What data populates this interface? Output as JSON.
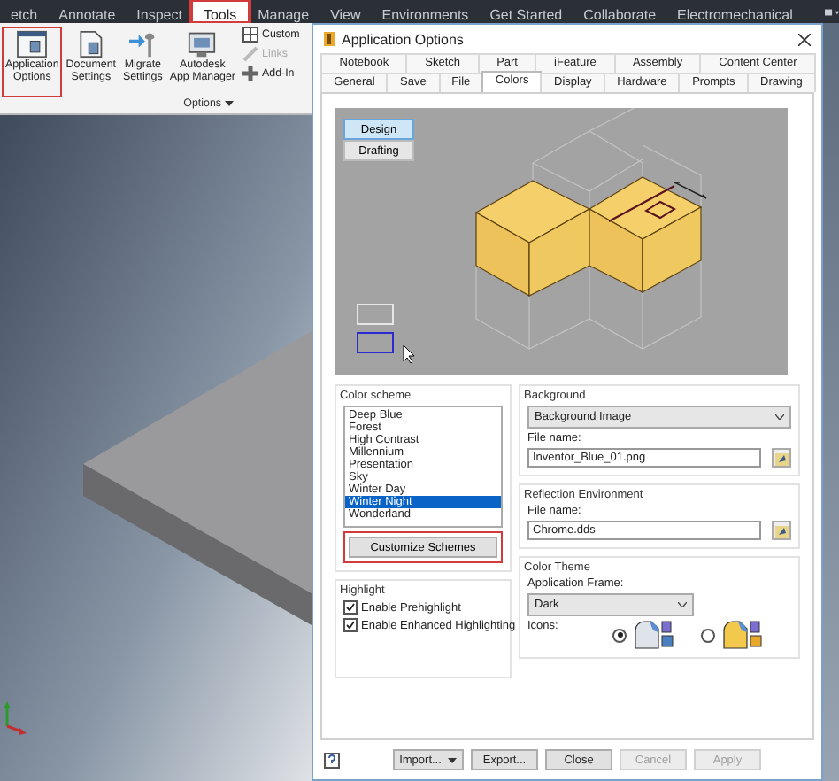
{
  "ribbon_tabs": [
    {
      "label": "etch",
      "selected": false,
      "highlighted": false
    },
    {
      "label": "Annotate",
      "selected": false,
      "highlighted": false
    },
    {
      "label": "Inspect",
      "selected": false,
      "highlighted": false
    },
    {
      "label": "Tools",
      "selected": true,
      "highlighted": true
    },
    {
      "label": "Manage",
      "selected": false,
      "highlighted": false
    },
    {
      "label": "View",
      "selected": false,
      "highlighted": false
    },
    {
      "label": "Environments",
      "selected": false,
      "highlighted": false
    },
    {
      "label": "Get Started",
      "selected": false,
      "highlighted": false
    },
    {
      "label": "Collaborate",
      "selected": false,
      "highlighted": false
    },
    {
      "label": "Electromechanical",
      "selected": false,
      "highlighted": false
    }
  ],
  "ribbon_panel": {
    "label": "Options",
    "large_buttons": [
      {
        "label": "Application\nOptions",
        "kind": "app-options",
        "highlighted": true
      },
      {
        "label": "Document\nSettings",
        "kind": "document",
        "highlighted": false
      },
      {
        "label": "Migrate\nSettings",
        "kind": "migrate",
        "highlighted": false
      },
      {
        "label": "Autodesk\nApp Manager",
        "kind": "app-manager",
        "highlighted": false
      }
    ],
    "small_buttons": [
      {
        "label": "Custom",
        "kind": "customize",
        "disabled": false
      },
      {
        "label": "Links",
        "kind": "links",
        "disabled": true
      },
      {
        "label": "Add-In",
        "kind": "add-ins",
        "disabled": false
      }
    ]
  },
  "dialog": {
    "title": "Application Options",
    "tabs_row_1": [
      {
        "label": "Notebook",
        "selected": false
      },
      {
        "label": "Sketch",
        "selected": false
      },
      {
        "label": "Part",
        "selected": false
      },
      {
        "label": "iFeature",
        "selected": false
      },
      {
        "label": "Assembly",
        "selected": false
      },
      {
        "label": "Content Center",
        "selected": false
      }
    ],
    "tabs_row_2": [
      {
        "label": "General",
        "selected": false
      },
      {
        "label": "Save",
        "selected": false
      },
      {
        "label": "File",
        "selected": false
      },
      {
        "label": "Colors",
        "selected": true
      },
      {
        "label": "Display",
        "selected": false
      },
      {
        "label": "Hardware",
        "selected": false
      },
      {
        "label": "Prompts",
        "selected": false
      },
      {
        "label": "Drawing",
        "selected": false
      }
    ],
    "preview_modes": [
      {
        "label": "Design",
        "selected": true
      },
      {
        "label": "Drafting",
        "selected": false
      }
    ],
    "color_scheme": {
      "title": "Color scheme",
      "items": [
        {
          "label": "Deep Blue",
          "selected": false
        },
        {
          "label": "Forest",
          "selected": false
        },
        {
          "label": "High Contrast",
          "selected": false
        },
        {
          "label": "Millennium",
          "selected": false
        },
        {
          "label": "Presentation",
          "selected": false
        },
        {
          "label": "Sky",
          "selected": false
        },
        {
          "label": "Winter Day",
          "selected": false
        },
        {
          "label": "Winter Night",
          "selected": true
        },
        {
          "label": "Wonderland",
          "selected": false
        }
      ],
      "customize_button": {
        "label": "Customize Schemes",
        "highlighted": true
      }
    },
    "highlight": {
      "title": "Highlight",
      "options": [
        {
          "label": "Enable Prehighlight",
          "checked": true
        },
        {
          "label": "Enable Enhanced Highlighting",
          "checked": true
        }
      ]
    },
    "background": {
      "title": "Background",
      "dropdown": "Background Image",
      "file_label": "File name:",
      "file_value": "Inventor_Blue_01.png"
    },
    "reflection": {
      "title": "Reflection Environment",
      "file_label": "File name:",
      "file_value": "Chrome.dds"
    },
    "color_theme": {
      "title": "Color Theme",
      "frame_label": "Application Frame:",
      "frame_value": "Dark",
      "icons_label": "Icons:",
      "icon_options": [
        {
          "kind": "classic",
          "selected": true
        },
        {
          "kind": "modern",
          "selected": false
        }
      ]
    },
    "footer_buttons": [
      {
        "label": "Import...",
        "kind": "split",
        "disabled": false
      },
      {
        "label": "Export...",
        "kind": "plain",
        "disabled": false
      },
      {
        "label": "Close",
        "kind": "plain",
        "disabled": false
      },
      {
        "label": "Cancel",
        "kind": "plain",
        "disabled": true
      },
      {
        "label": "Apply",
        "kind": "plain",
        "disabled": true
      }
    ]
  }
}
